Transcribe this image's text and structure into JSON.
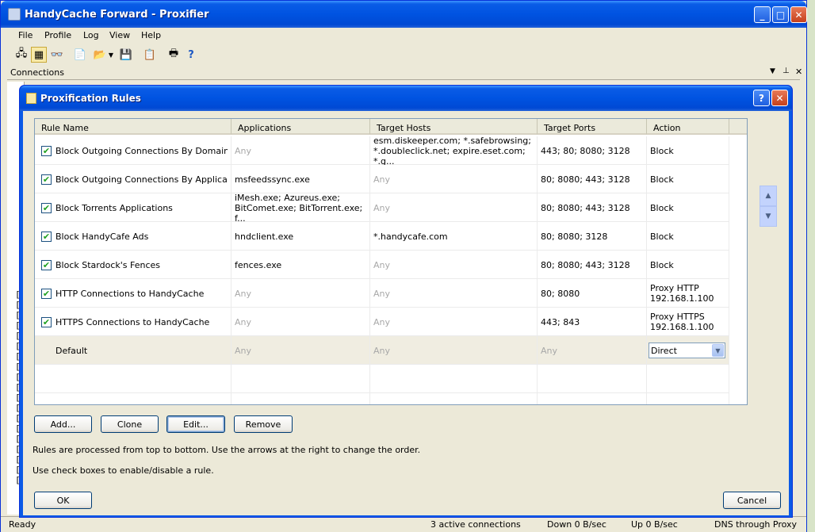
{
  "main_window": {
    "title": "HandyCache Forward - Proxifier",
    "menu": [
      "File",
      "Profile",
      "Log",
      "View",
      "Help"
    ],
    "connections_label": "Connections",
    "status": {
      "ready": "Ready",
      "active": "3 active connections",
      "down": "Down 0 B/sec",
      "up": "Up 0 B/sec",
      "dns": "DNS through Proxy"
    }
  },
  "dialog": {
    "title": "Proxification Rules",
    "columns": [
      "Rule Name",
      "Applications",
      "Target Hosts",
      "Target Ports",
      "Action"
    ],
    "rules": [
      {
        "checked": true,
        "name": "Block Outgoing Connections By Domain",
        "applications": "Any",
        "hosts": "esm.diskeeper.com; *.safebrowsing; *.doubleclick.net; expire.eset.com; *.g...",
        "ports": "443; 80; 8080; 3128",
        "action": "Block"
      },
      {
        "checked": true,
        "name": "Block Outgoing Connections By Application",
        "applications": "msfeedssync.exe",
        "hosts": "Any",
        "ports": "80; 8080; 443; 3128",
        "action": "Block"
      },
      {
        "checked": true,
        "name": "Block Torrents Applications",
        "applications": "iMesh.exe; Azureus.exe; BitComet.exe; BitTorrent.exe; f...",
        "hosts": "Any",
        "ports": "80; 8080; 443; 3128",
        "action": "Block"
      },
      {
        "checked": true,
        "name": "Block HandyCafe Ads",
        "applications": "hndclient.exe",
        "hosts": "*.handycafe.com",
        "ports": "80; 8080; 3128",
        "action": "Block"
      },
      {
        "checked": true,
        "name": "Block Stardock's Fences",
        "applications": "fences.exe",
        "hosts": "Any",
        "ports": "80; 8080; 443; 3128",
        "action": "Block"
      },
      {
        "checked": true,
        "name": "HTTP Connections to HandyCache",
        "applications": "Any",
        "hosts": "Any",
        "ports": "80; 8080",
        "action": "Proxy HTTP 192.168.1.100"
      },
      {
        "checked": true,
        "name": "HTTPS Connections to HandyCache",
        "applications": "Any",
        "hosts": "Any",
        "ports": "443; 843",
        "action": "Proxy HTTPS 192.168.1.100"
      }
    ],
    "default_rule": {
      "name": "Default",
      "applications": "Any",
      "hosts": "Any",
      "ports": "Any",
      "action": "Direct"
    },
    "buttons": {
      "add": "Add...",
      "clone": "Clone",
      "edit": "Edit...",
      "remove": "Remove",
      "ok": "OK",
      "cancel": "Cancel"
    },
    "hint1": "Rules are processed from top to bottom. Use the arrows at the right to change the order.",
    "hint2": "Use check boxes to enable/disable a rule.",
    "help_glyph": "?",
    "close_glyph": "✕"
  },
  "log_brackets": [
    "[",
    "[",
    "[",
    "[",
    "[",
    "[",
    "[",
    "[",
    "[",
    "[",
    "[",
    "[",
    "[",
    "[",
    "[",
    "[",
    "[",
    "[",
    "["
  ]
}
